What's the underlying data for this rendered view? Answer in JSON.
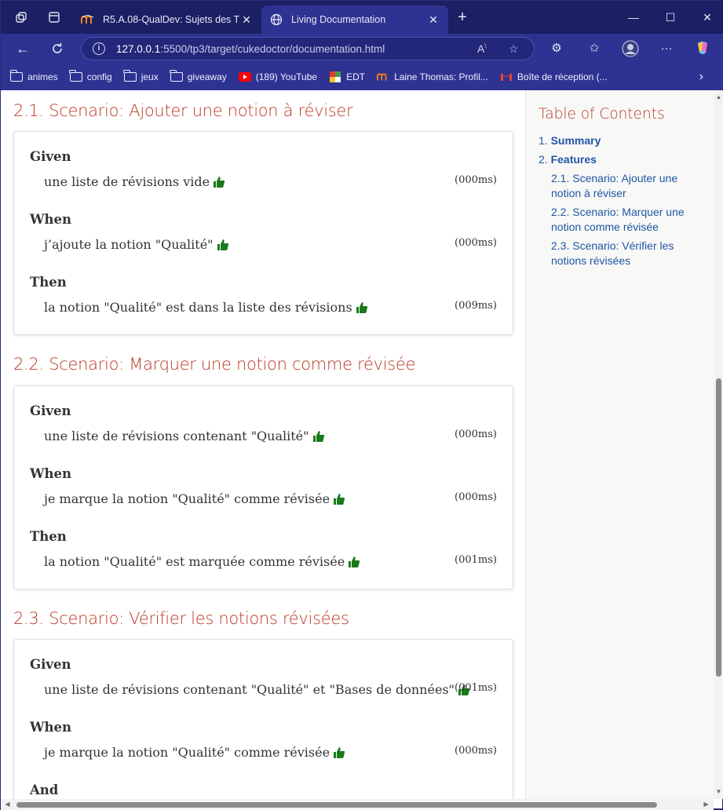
{
  "browser": {
    "tabs": [
      {
        "title": "R5.A.08-QualDev: Sujets des TPs",
        "close": "✕"
      },
      {
        "title": "Living Documentation",
        "close": "✕"
      }
    ],
    "new_tab": "+",
    "url_host": "127.0.0.1",
    "url_rest": ":5500/tp3/target/cukedoctor/documentation.html",
    "bookmarks": [
      {
        "label": "animes",
        "icon": "folder-icon"
      },
      {
        "label": "config",
        "icon": "folder-icon"
      },
      {
        "label": "jeux",
        "icon": "folder-icon"
      },
      {
        "label": "giveaway",
        "icon": "folder-icon"
      },
      {
        "label": "(189) YouTube",
        "icon": "youtube-icon"
      },
      {
        "label": "EDT",
        "icon": "edt-icon"
      },
      {
        "label": "Laine Thomas: Profil...",
        "icon": "moodle-icon"
      },
      {
        "label": "Boîte de réception (...",
        "icon": "gmail-icon"
      }
    ]
  },
  "scenarios": [
    {
      "title": "2.1. Scenario: Ajouter une notion à réviser",
      "steps": [
        {
          "keyword": "Given",
          "text": "une liste de révisions vide",
          "duration": "(000ms)"
        },
        {
          "keyword": "When",
          "text": "j’ajoute la notion \"Qualité\"",
          "duration": "(000ms)"
        },
        {
          "keyword": "Then",
          "text": "la notion \"Qualité\" est dans la liste des révisions",
          "duration": "(009ms)"
        }
      ]
    },
    {
      "title": "2.2. Scenario: Marquer une notion comme révisée",
      "steps": [
        {
          "keyword": "Given",
          "text": "une liste de révisions contenant \"Qualité\"",
          "duration": "(000ms)"
        },
        {
          "keyword": "When",
          "text": "je marque la notion \"Qualité\" comme révisée",
          "duration": "(000ms)"
        },
        {
          "keyword": "Then",
          "text": "la notion \"Qualité\" est marquée comme révisée",
          "duration": "(001ms)"
        }
      ]
    },
    {
      "title": "2.3. Scenario: Vérifier les notions révisées",
      "steps": [
        {
          "keyword": "Given",
          "text": "une liste de révisions contenant \"Qualité\" et \"Bases de données\"",
          "duration": "(001ms)"
        },
        {
          "keyword": "When",
          "text": "je marque la notion \"Qualité\" comme révisée",
          "duration": "(000ms)"
        },
        {
          "keyword": "And",
          "text": "",
          "duration": ""
        }
      ]
    }
  ],
  "toc": {
    "title": "Table of Contents",
    "items": [
      {
        "num": "1.",
        "label": "Summary"
      },
      {
        "num": "2.",
        "label": "Features"
      }
    ],
    "subitems": [
      "2.1. Scenario: Ajouter une notion à réviser",
      "2.2. Scenario: Marquer une notion comme révisée",
      "2.3. Scenario: Vérifier les notions révisées"
    ]
  },
  "colors": {
    "title_bar": "#1b1f63",
    "toolbar": "#2e3392",
    "scenario_title": "#ba3925",
    "toc_link": "#2156a5",
    "thumb_green": "#1a7a1a"
  }
}
